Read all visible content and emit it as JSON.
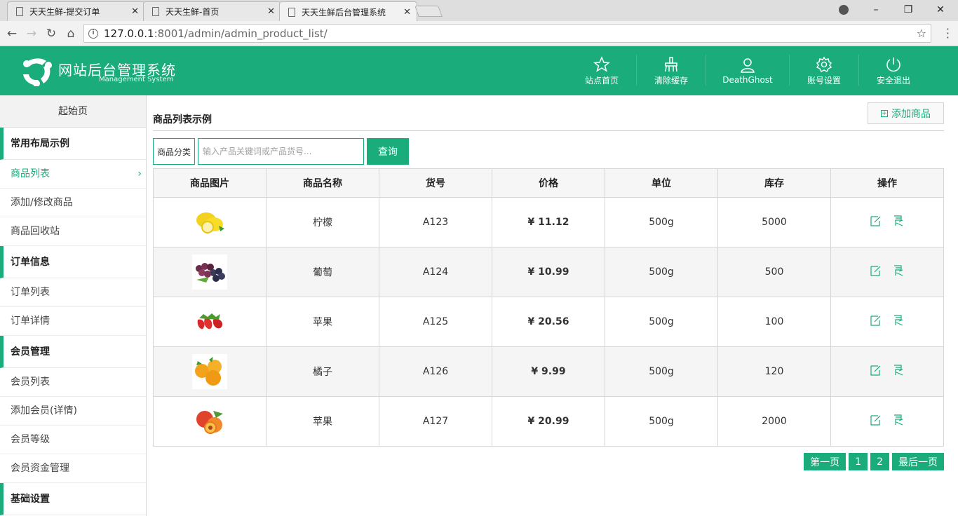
{
  "browser": {
    "tabs": [
      {
        "title": "天天生鲜-提交订单",
        "close": "✕"
      },
      {
        "title": "天天生鲜-首页",
        "close": "✕"
      },
      {
        "title": "天天生鲜后台管理系统",
        "close": "✕"
      }
    ],
    "url_host": "127.0.0.1",
    "url_rest": ":8001/admin/admin_product_list/",
    "window_controls": [
      "–",
      "❐",
      "✕"
    ]
  },
  "header": {
    "brand_title": "网站后台管理系统",
    "brand_subtitle": "Management System",
    "nav": [
      {
        "label": "站点首页",
        "icon": "star-icon"
      },
      {
        "label": "清除缓存",
        "icon": "broom-icon"
      },
      {
        "label": "DeathGhost",
        "icon": "user-icon"
      },
      {
        "label": "账号设置",
        "icon": "gear-icon"
      },
      {
        "label": "安全退出",
        "icon": "power-icon"
      }
    ],
    "accent": "#1aac7b"
  },
  "sidebar": {
    "home": "起始页",
    "groups": [
      {
        "title": "常用布局示例",
        "items": [
          "商品列表",
          "添加/修改商品",
          "商品回收站"
        ]
      },
      {
        "title": "订单信息",
        "items": [
          "订单列表",
          "订单详情"
        ]
      },
      {
        "title": "会员管理",
        "items": [
          "会员列表",
          "添加会员(详情)",
          "会员等级",
          "会员资金管理"
        ]
      },
      {
        "title": "基础设置",
        "items": []
      }
    ],
    "active_item": "商品列表"
  },
  "main": {
    "page_title": "商品列表示例",
    "add_button": "添加商品",
    "category_label": "商品分类",
    "search_placeholder": "输入产品关键词或产品货号...",
    "query_button": "查询",
    "columns": [
      "商品图片",
      "商品名称",
      "货号",
      "价格",
      "单位",
      "库存",
      "操作"
    ],
    "rows": [
      {
        "name": "柠檬",
        "sku": "A123",
        "price": "¥ 11.12",
        "unit": "500g",
        "stock": "5000",
        "image": "lemon"
      },
      {
        "name": "葡萄",
        "sku": "A124",
        "price": "¥ 10.99",
        "unit": "500g",
        "stock": "500",
        "image": "grape"
      },
      {
        "name": "苹果",
        "sku": "A125",
        "price": "¥ 20.56",
        "unit": "500g",
        "stock": "100",
        "image": "strawberry"
      },
      {
        "name": "橘子",
        "sku": "A126",
        "price": "¥ 9.99",
        "unit": "500g",
        "stock": "120",
        "image": "orange"
      },
      {
        "name": "苹果",
        "sku": "A127",
        "price": "¥ 20.99",
        "unit": "500g",
        "stock": "2000",
        "image": "peach"
      }
    ],
    "pagination": [
      "第一页",
      "1",
      "2",
      "最后一页"
    ]
  }
}
